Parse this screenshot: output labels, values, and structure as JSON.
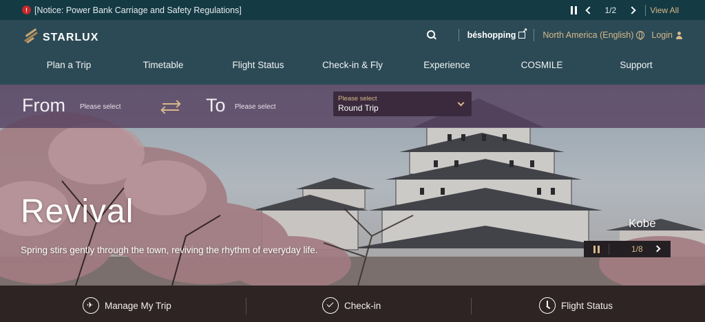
{
  "notice": {
    "icon": "alert-icon",
    "text": "[Notice: Power Bank Carriage and Safety Regulations]",
    "counter": "1/2",
    "view_all": "View All"
  },
  "header": {
    "brand": "STARLUX",
    "beshopping": "béshopping",
    "region": "North America (English)",
    "login": "Login",
    "nav": [
      "Plan a Trip",
      "Timetable",
      "Flight Status",
      "Check-in & Fly",
      "Experience",
      "COSMILE",
      "Support"
    ]
  },
  "booking": {
    "from_label": "From",
    "from_placeholder": "Please select",
    "to_label": "To",
    "to_placeholder": "Please select",
    "trip_type_placeholder": "Please select",
    "trip_type_value": "Round Trip"
  },
  "hero": {
    "title": "Revival",
    "subtitle": "Spring stirs gently through the town, reviving the rhythm of everyday life.",
    "location": "Kobe",
    "slide_counter": "1/8"
  },
  "quickbar": {
    "items": [
      "Manage My Trip",
      "Check-in",
      "Flight Status"
    ]
  },
  "colors": {
    "notice_bg": "#143a44",
    "header_bg": "#2c4a55",
    "accent_gold": "#d7b98b",
    "booking_bg": "#584260",
    "quickbar_bg": "#2e2423"
  }
}
